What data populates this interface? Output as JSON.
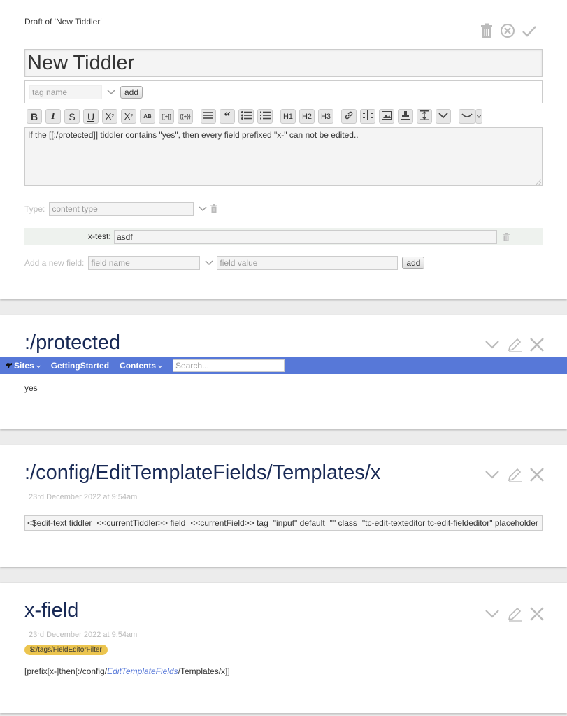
{
  "draft": {
    "label": "Draft of 'New Tiddler'",
    "title_value": "New Tiddler",
    "tag_placeholder": "tag name",
    "tag_add_label": "add",
    "toolbar": {
      "bold": "B",
      "italic": "I",
      "strike": "S",
      "underline": "U",
      "superscript": "X",
      "sup_mark": "2",
      "subscript": "X",
      "sub_mark": "2",
      "smallcaps": "AB",
      "wikilink": "[[+]]",
      "transclude": "{{+}}",
      "h1": "H1",
      "h2": "H2",
      "h3": "H3"
    },
    "text": "If the [[:/protected]] tiddler contains \"yes\", then every field prefixed \"x-\" can not be edited..",
    "type_label": "Type:",
    "type_placeholder": "content type",
    "field": {
      "name": "x-test:",
      "value": "asdf"
    },
    "new_field_label": "Add a new field:",
    "new_field_name_placeholder": "field name",
    "new_field_value_placeholder": "field value",
    "new_field_add_label": "add"
  },
  "protected": {
    "title": ":/protected",
    "body": "yes"
  },
  "topbar": {
    "sites": "Sites",
    "getting_started": "GettingStarted",
    "contents": "Contents",
    "search_placeholder": "Search..."
  },
  "template": {
    "title": ":/config/EditTemplateFields/Templates/x",
    "modified": "23rd December 2022 at 9:54am",
    "code": "<$edit-text tiddler=<<currentTiddler>> field=<<currentField>> tag=\"input\" default=\"\" class=\"tc-edit-texteditor tc-edit-fieldeditor\" placeholder"
  },
  "xfield": {
    "title": "x-field",
    "modified": "23rd December 2022 at 9:54am",
    "tag": "$:/tags/FieldEditorFilter",
    "body_pre": "[prefix[x-]then[:/config/",
    "body_link": "EditTemplateFields",
    "body_post": "/Templates/x]]"
  },
  "colors": {
    "accent": "#5778d8",
    "title": "#182955",
    "tag": "#ecc54f"
  }
}
